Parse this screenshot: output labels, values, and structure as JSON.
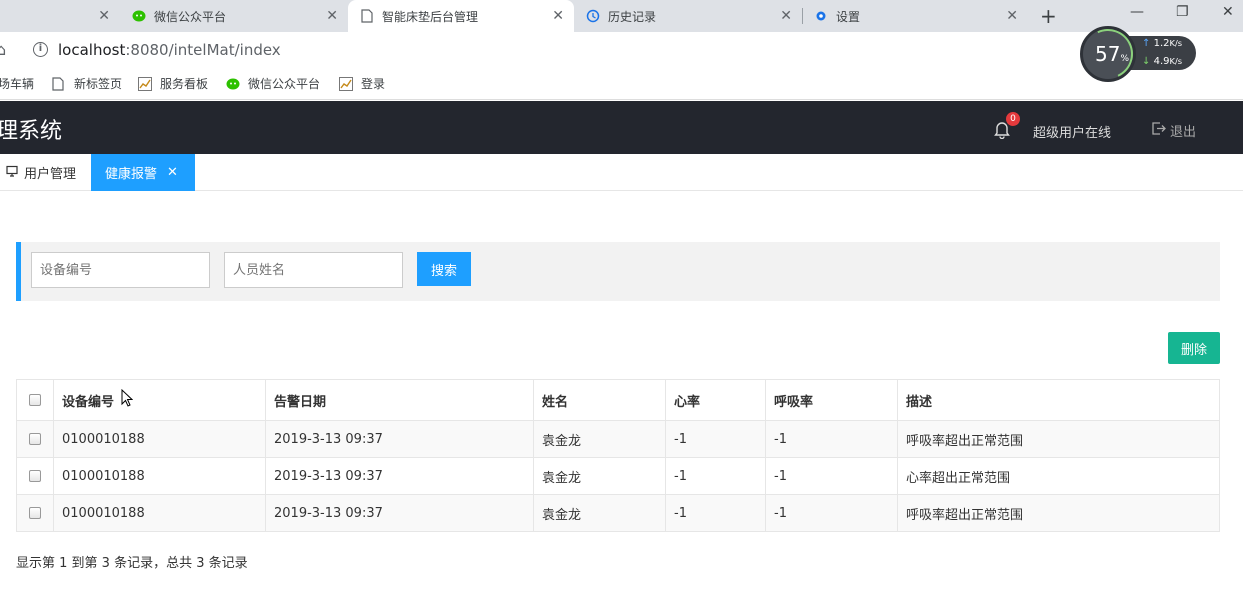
{
  "browser": {
    "tabs": [
      {
        "label": "",
        "close": "✕"
      },
      {
        "label": "微信公众平台",
        "close": "✕"
      },
      {
        "label": "智能床垫后台管理",
        "close": "✕"
      },
      {
        "label": "历史记录",
        "close": "✕"
      },
      {
        "label": "设置",
        "close": "✕"
      }
    ],
    "url_host": "localhost",
    "url_rest": ":8080/intelMat/index",
    "bookmarks": [
      "场车辆",
      "新标签页",
      "服务看板",
      "微信公众平台",
      "登录"
    ],
    "net_monitor": {
      "percent": "57",
      "percent_unit": "%",
      "up": "1.2",
      "down": "4.9",
      "rate_unit": "K/s"
    }
  },
  "app": {
    "title": "理系统",
    "notification_count": "0",
    "user_status": "超级用户在线",
    "logout_label": "退出"
  },
  "page_tabs": {
    "user_mgmt": "用户管理",
    "health_alert": "健康报警"
  },
  "search": {
    "device_placeholder": "设备编号",
    "name_placeholder": "人员姓名",
    "search_label": "搜索"
  },
  "actions": {
    "delete_label": "删除"
  },
  "table": {
    "headers": [
      "设备编号",
      "告警日期",
      "姓名",
      "心率",
      "呼吸率",
      "描述"
    ],
    "rows": [
      [
        "0100010188",
        "2019-3-13 09:37",
        "袁金龙",
        "-1",
        "-1",
        "呼吸率超出正常范围"
      ],
      [
        "0100010188",
        "2019-3-13 09:37",
        "袁金龙",
        "-1",
        "-1",
        "心率超出正常范围"
      ],
      [
        "0100010188",
        "2019-3-13 09:37",
        "袁金龙",
        "-1",
        "-1",
        "呼吸率超出正常范围"
      ]
    ]
  },
  "pagination_text": "显示第 1 到第 3 条记录，总共 3 条记录",
  "colors": {
    "accent": "#1e9fff",
    "delete": "#16b592",
    "header_bg": "#23262e"
  }
}
